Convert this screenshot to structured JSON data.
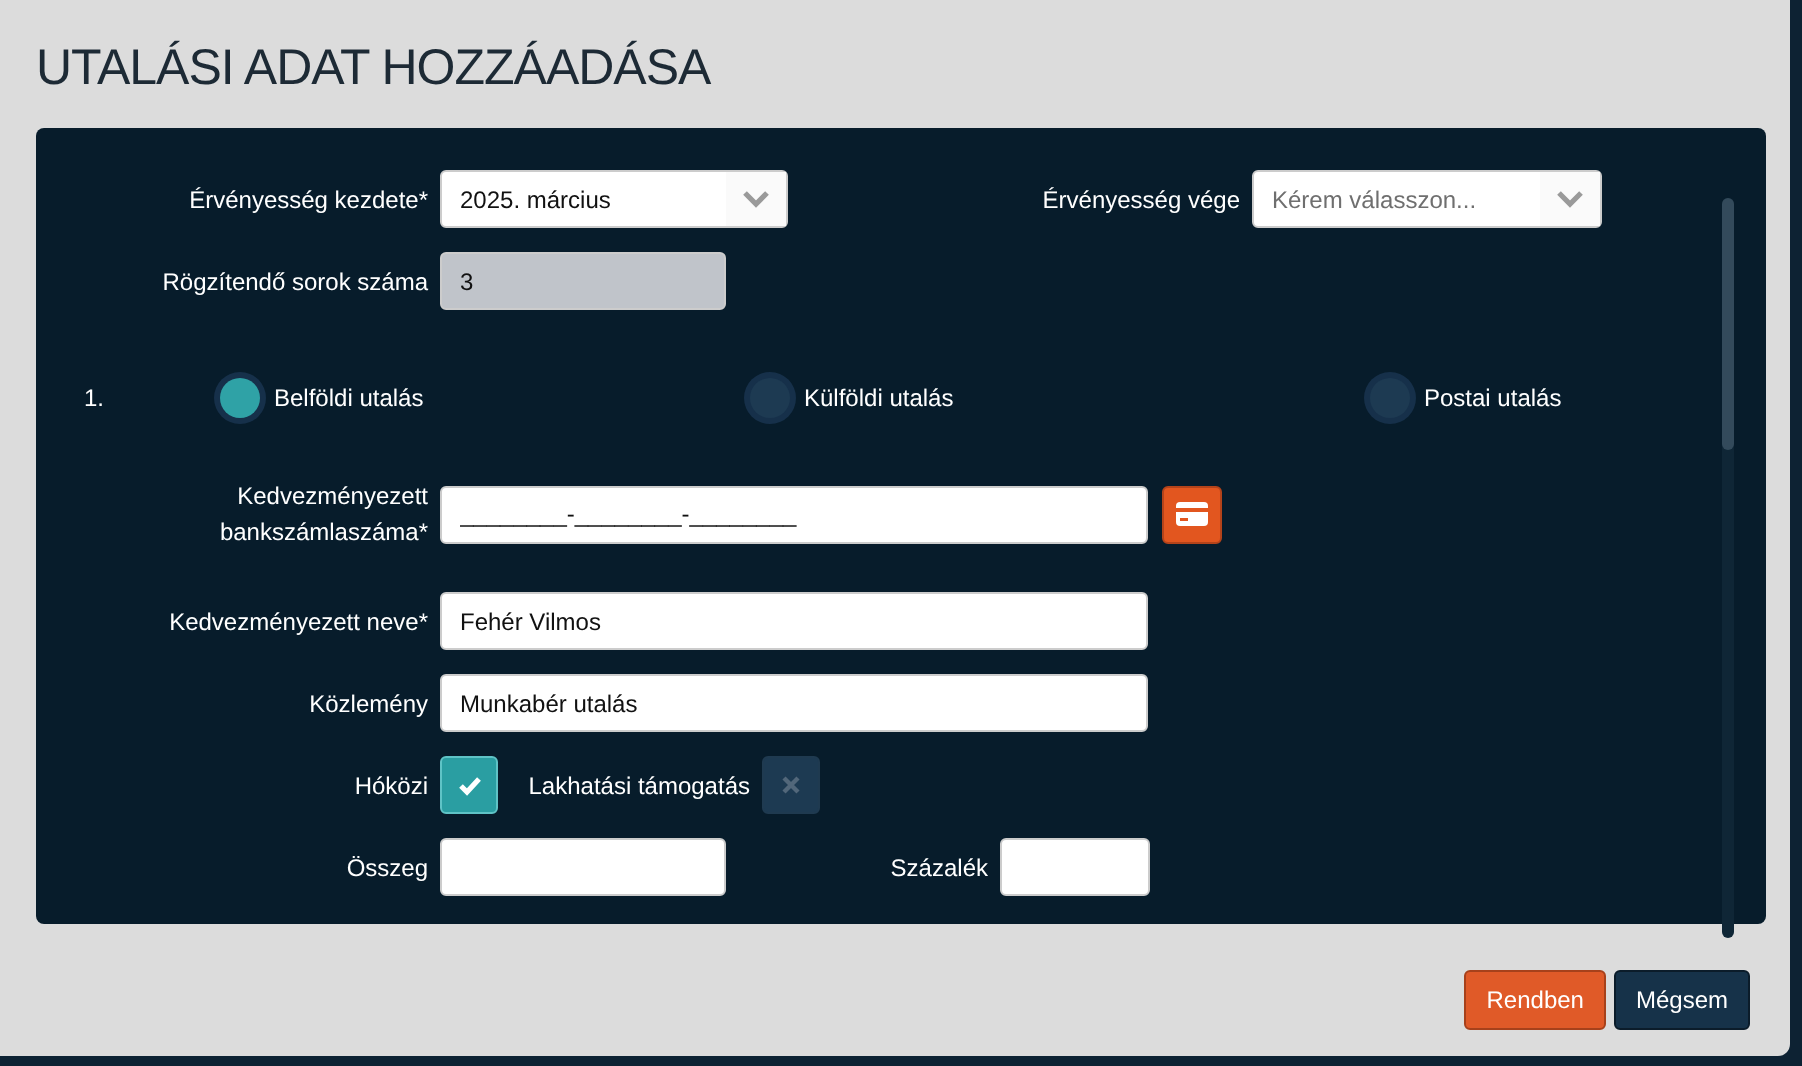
{
  "dialog": {
    "title": "UTALÁSI ADAT HOZZÁADÁSA"
  },
  "period": [
    {
      "label": "Érvényesség kezdete*",
      "value": "2025. március"
    },
    {
      "label": "Érvényesség vége",
      "placeholder": "Kérem válasszon..."
    }
  ],
  "row_count": {
    "label": "Rögzítendő sorok száma",
    "value": "3",
    "disabled": true
  },
  "entry": {
    "number": "1.",
    "transfer_types": [
      {
        "label": "Belföldi utalás",
        "selected": true
      },
      {
        "label": "Külföldi utalás",
        "selected": false
      },
      {
        "label": "Postai utalás",
        "selected": false
      }
    ],
    "account": {
      "label": "Kedvezményezett bankszámlaszáma*",
      "value": "________-________-________"
    },
    "name": {
      "label": "Kedvezményezett neve*",
      "value": "Fehér Vilmos"
    },
    "note": {
      "label": "Közlemény",
      "value": "Munkabér utalás"
    },
    "flags": [
      {
        "label": "Hóközi",
        "checked": true
      },
      {
        "label": "Lakhatási támogatás",
        "checked": false
      }
    ],
    "amount": {
      "label": "Összeg"
    },
    "percent": {
      "label": "Százalék"
    }
  },
  "buttons": [
    {
      "label": "Rendben",
      "kind": "primary"
    },
    {
      "label": "Mégsem",
      "kind": "secondary"
    }
  ]
}
